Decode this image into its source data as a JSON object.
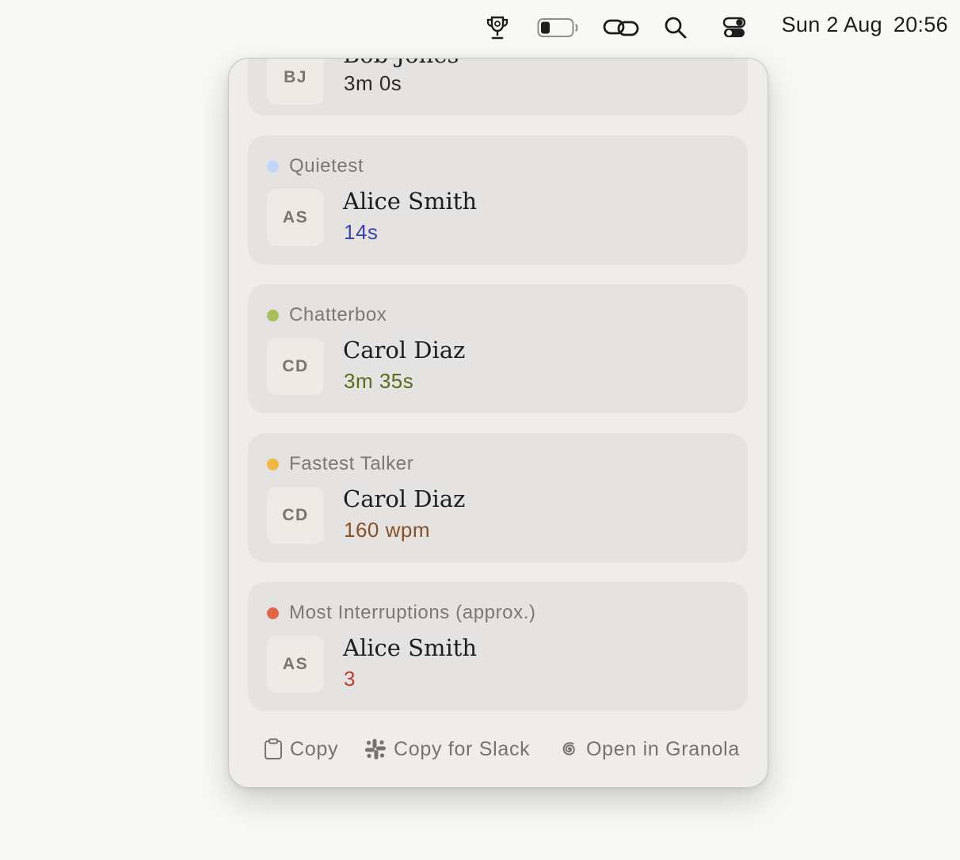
{
  "menubar": {
    "icons": [
      "trophy-icon",
      "battery-icon",
      "link-icon",
      "search-icon",
      "control-center-icon"
    ],
    "date": "Sun 2 Aug",
    "time": "20:56"
  },
  "popover": {
    "cards": [
      {
        "label": "",
        "initials": "BJ",
        "name": "Bob Jones",
        "value": "3m 0s",
        "dot_color": "",
        "value_color": "#2f2a22"
      },
      {
        "label": "Quietest",
        "initials": "AS",
        "name": "Alice Smith",
        "value": "14s",
        "dot_color": "#c2d4f7",
        "value_color": "#3c43a8"
      },
      {
        "label": "Chatterbox",
        "initials": "CD",
        "name": "Carol Diaz",
        "value": "3m 35s",
        "dot_color": "#a9bf5b",
        "value_color": "#5a6b1c"
      },
      {
        "label": "Fastest Talker",
        "initials": "CD",
        "name": "Carol Diaz",
        "value": "160 wpm",
        "dot_color": "#f1b743",
        "value_color": "#8a4f22"
      },
      {
        "label": "Most Interruptions (approx.)",
        "initials": "AS",
        "name": "Alice Smith",
        "value": "3",
        "dot_color": "#df6647",
        "value_color": "#b4412f"
      }
    ],
    "footer": {
      "copy_label": "Copy",
      "copy_slack_label": "Copy for Slack",
      "open_granola_label": "Open in Granola"
    }
  }
}
